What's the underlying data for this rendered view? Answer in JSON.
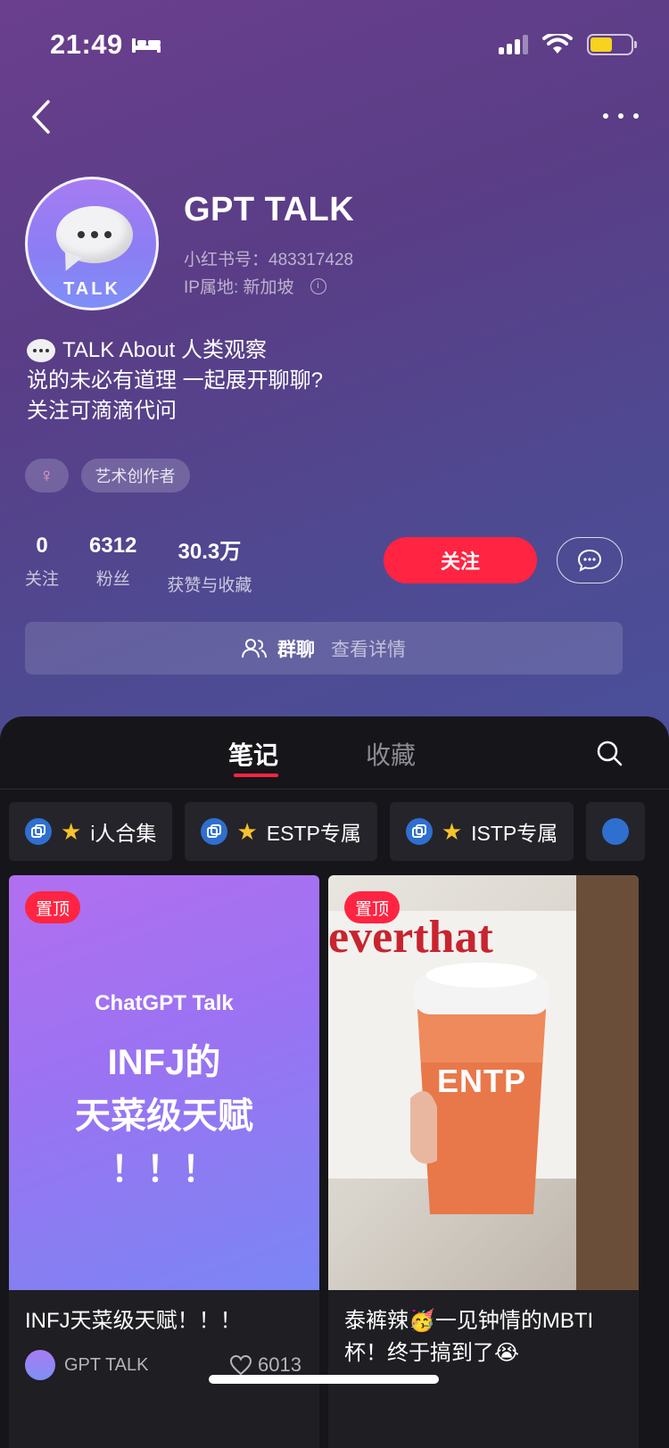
{
  "status_bar": {
    "time": "21:49"
  },
  "profile": {
    "name": "GPT TALK",
    "avatar_label": "TALK",
    "id_label": "小红书号：483317428",
    "location_label": "IP属地: 新加坡",
    "bio_line1": "TALK About 人类观察",
    "bio_line2": "说的未必有道理 一起展开聊聊?",
    "bio_line3": "关注可滴滴代问",
    "tags": [
      "♀",
      "艺术创作者"
    ],
    "stats": [
      {
        "value": "0",
        "label": "关注"
      },
      {
        "value": "6312",
        "label": "粉丝"
      },
      {
        "value": "30.3万",
        "label": "获赞与收藏"
      }
    ],
    "follow_label": "关注",
    "group_title": "群聊",
    "group_detail": "查看详情"
  },
  "tabs": [
    {
      "label": "笔记",
      "active": true
    },
    {
      "label": "收藏",
      "active": false
    }
  ],
  "collections": [
    {
      "label": "i人合集"
    },
    {
      "label": "ESTP专属"
    },
    {
      "label": "ISTP专属"
    }
  ],
  "cards": [
    {
      "badge": "置顶",
      "cover_sub": "ChatGPT Talk",
      "cover_title_line1": "INFJ的",
      "cover_title_line2": "天菜级天赋",
      "cover_title_line3": "！！！",
      "title": "INFJ天菜级天赋！！！",
      "author": "GPT TALK",
      "likes": "6013"
    },
    {
      "badge": "置顶",
      "cup_text": "ENTP",
      "shirt_text": "everthat",
      "title": "泰裤辣🥳一见钟情的MBTI杯！终于搞到了😭"
    }
  ],
  "colors": {
    "accent": "#ff2442",
    "hero_start": "#6a3f8e",
    "hero_end": "#4a4f9a",
    "collection_icon": "#2f6fcf"
  }
}
